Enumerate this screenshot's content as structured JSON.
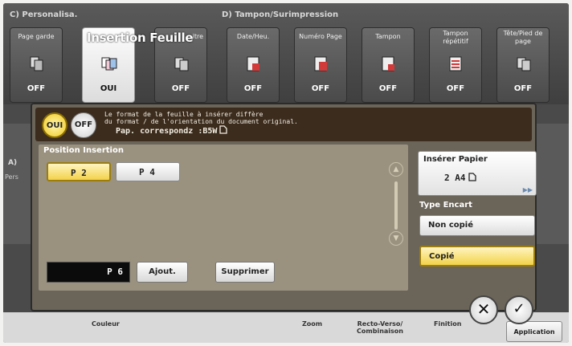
{
  "sections": {
    "personalise_title": "C)  Personalisa.",
    "tampon_title": "D)  Tampon/Surimpression"
  },
  "tabs": [
    {
      "label": "Page garde",
      "value": "OFF",
      "icon": "cover-page-icon"
    },
    {
      "label": "Insertion Feuille",
      "value": "OUI",
      "icon": "insert-sheet-icon"
    },
    {
      "label": "...itre",
      "value": "OFF",
      "icon": "chapter-icon"
    },
    {
      "label": "Date/Heu.",
      "value": "OFF",
      "icon": "date-stamp-icon"
    },
    {
      "label": "Numéro Page",
      "value": "OFF",
      "icon": "page-number-icon"
    },
    {
      "label": "Tampon",
      "value": "OFF",
      "icon": "stamp-icon"
    },
    {
      "label": "Tampon répétitif",
      "value": "OFF",
      "icon": "repeat-stamp-icon"
    },
    {
      "label": "Tête/Pied de page",
      "value": "OFF",
      "icon": "header-footer-icon"
    }
  ],
  "active_tab_title": "Insertion Feuille",
  "background": {
    "left_a": "A)",
    "left_b": "Pers",
    "bottom": [
      "Couleur",
      "Zoom",
      "Recto-Verso/ Combinaison",
      "Finition"
    ],
    "application": "Application"
  },
  "dialog": {
    "oui": "OUI",
    "off": "OFF",
    "message_line1": "Le format de la feuille à insérer diffère",
    "message_line2": "du format / de l'orientation du document original.",
    "message_line3": "Pap. correspondz :B5W",
    "position_title": "Position Insertion",
    "positions": [
      "P 2",
      "P 4"
    ],
    "page_input": "P 6",
    "add": "Ajout.",
    "delete": "Supprimer",
    "insert_paper_title": "Insérer Papier",
    "insert_paper_value": "2 A4",
    "type_title": "Type Encart",
    "type_options": [
      "Non copié",
      "Copié"
    ],
    "selected_type": "Copié"
  },
  "colors": {
    "accent": "#f2d24a",
    "dialog": "#6b6459",
    "message_bar": "#3b2c1e"
  }
}
